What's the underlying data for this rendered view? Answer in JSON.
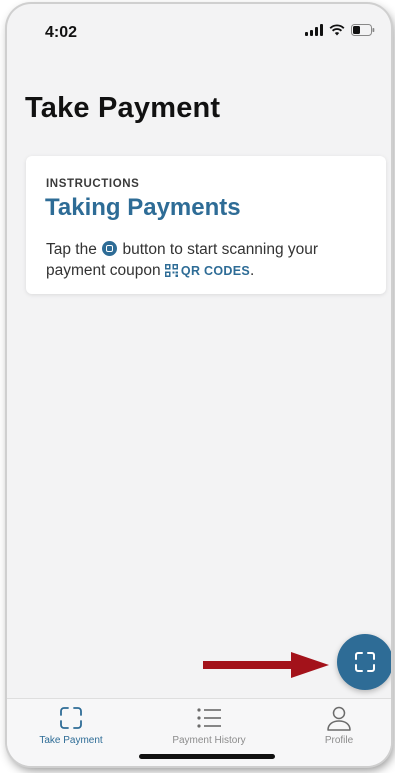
{
  "status_bar": {
    "time": "4:02",
    "signal_icon": "signal-icon",
    "wifi_icon": "wifi-icon",
    "battery_icon": "battery-icon"
  },
  "header": {
    "title": "Take Payment"
  },
  "card": {
    "label": "INSTRUCTIONS",
    "heading": "Taking Payments",
    "body_part1": "Tap the",
    "body_part2": "button to start scanning your payment coupon",
    "qr_link_label": "QR CODES",
    "body_end": "."
  },
  "fab": {
    "icon": "scan-frame-icon"
  },
  "tabs": [
    {
      "label": "Take Payment",
      "icon": "scan-frame-icon",
      "active": true
    },
    {
      "label": "Payment History",
      "icon": "list-icon",
      "active": false
    },
    {
      "label": "Profile",
      "icon": "person-icon",
      "active": false
    }
  ],
  "colors": {
    "accent": "#2e6c96",
    "annotation_arrow": "#a3121a",
    "background": "#f3f3f4",
    "card": "#ffffff"
  }
}
